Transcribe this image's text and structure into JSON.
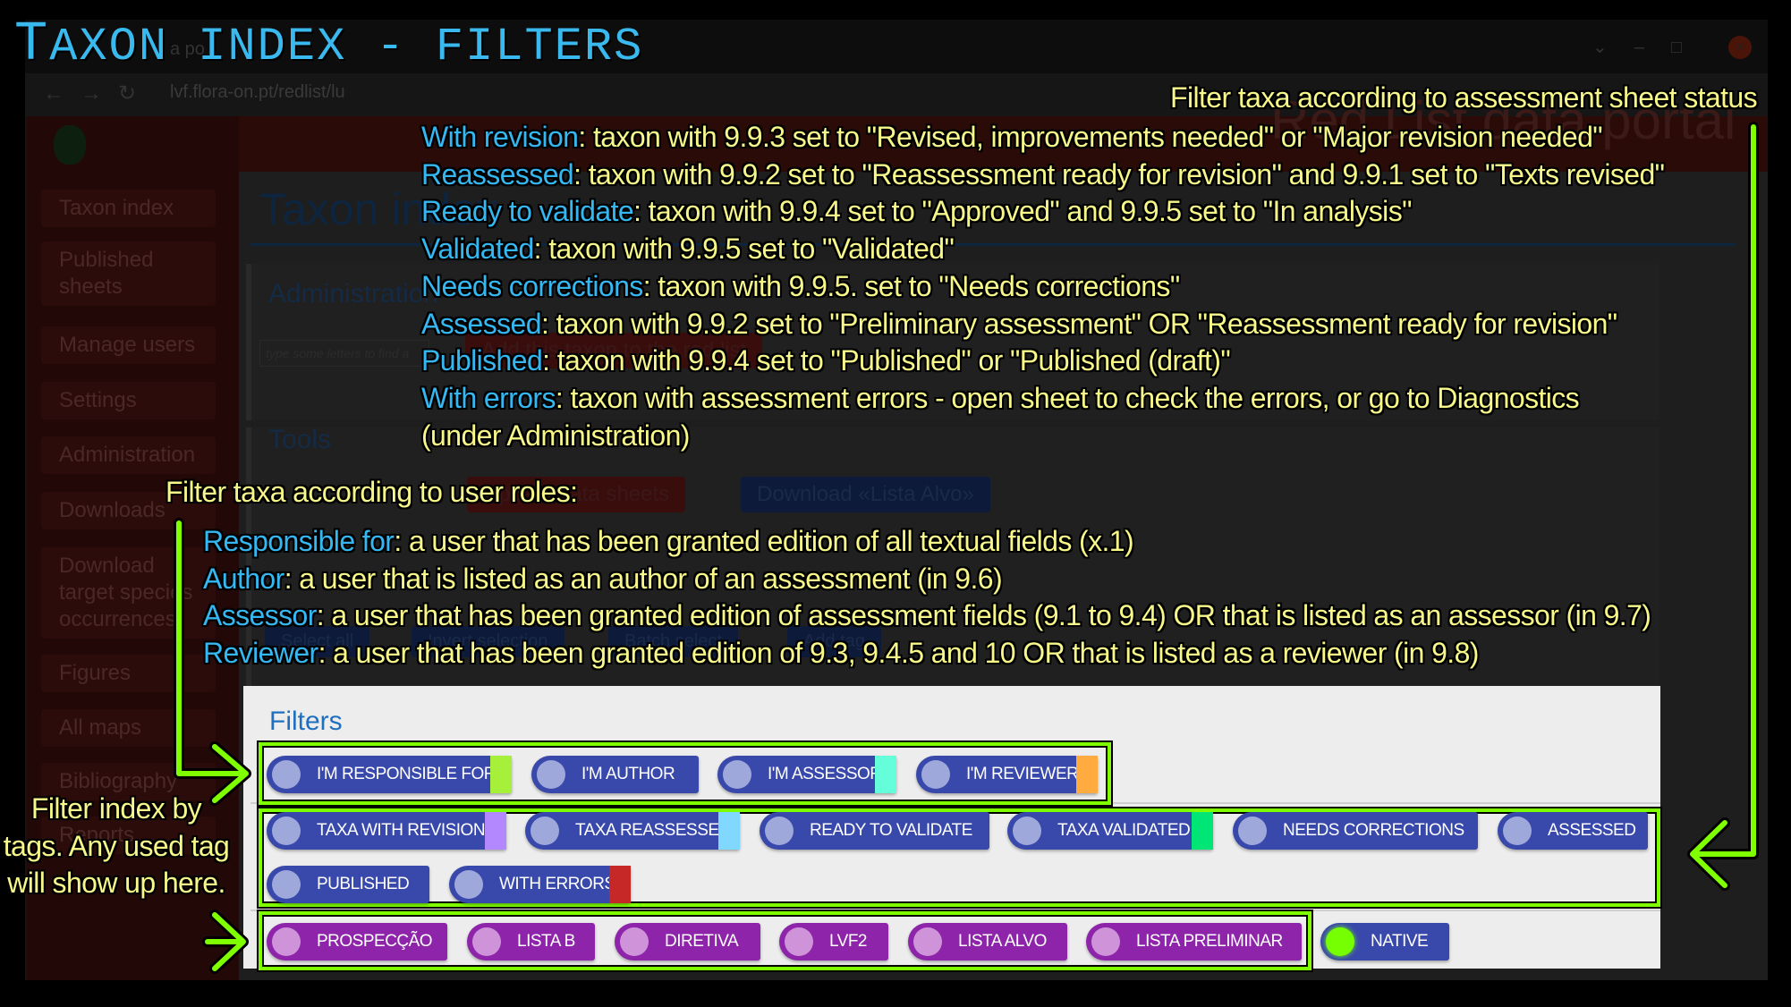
{
  "title": "Taxon index - filters",
  "browser": {
    "tab_text": "a po",
    "url": "lvf.flora-on.pt/redlist/lu",
    "nav_icons": [
      "back-icon",
      "forward-icon",
      "reload-icon"
    ]
  },
  "app": {
    "portal_title": "Red List data portal",
    "sidebar": [
      "Taxon index",
      "Published sheets",
      "Manage users",
      "Settings",
      "Administration",
      "Downloads",
      "Download target species occurrences",
      "Figures",
      "All maps",
      "Bibliography",
      "Reports"
    ],
    "page_title": "Taxon index",
    "admin_title": "Administration",
    "search_placeholder": "type some letters to find a",
    "add_taxon_button": "Add this taxon to the red list",
    "tools_title": "Tools",
    "update_button": "Update data sheets",
    "download_button": "Download «Lista Alvo»",
    "select_buttons": [
      "Select all",
      "Invert selection",
      "Batch select",
      "Add tag"
    ]
  },
  "filters": {
    "title": "Filters",
    "roles": [
      {
        "label": "I'm responsible for",
        "color": "#a6f03c"
      },
      {
        "label": "I'm author",
        "color": ""
      },
      {
        "label": "I'm assessor",
        "color": "#64ffda"
      },
      {
        "label": "I'm reviewer",
        "color": "#ffab40"
      }
    ],
    "status": [
      {
        "label": "Taxa with revision",
        "color": "#b388ff"
      },
      {
        "label": "Taxa reassessed",
        "color": "#80d8ff"
      },
      {
        "label": "Ready to validate",
        "color": ""
      },
      {
        "label": "Taxa validated",
        "color": "#00e676"
      },
      {
        "label": "Needs corrections",
        "color": ""
      },
      {
        "label": "Assessed",
        "color": ""
      },
      {
        "label": "Published",
        "color": ""
      },
      {
        "label": "With errors",
        "color": "#c62828"
      }
    ],
    "tags": [
      "Prospecção",
      "Lista B",
      "Diretiva",
      "LVF2",
      "Lista Alvo",
      "Lista preliminar"
    ],
    "native": {
      "label": "Native",
      "color": "#76ff03"
    }
  },
  "annotations": {
    "status_header": "Filter taxa according to assessment sheet status",
    "status_items": [
      {
        "key": "With revision",
        "text": ": taxon with 9.9.3 set to \"Revised, improvements needed\" or \"Major revision needed\""
      },
      {
        "key": "Reassessed",
        "text": ": taxon with 9.9.2 set to \"Reassessment ready for revision\" and 9.9.1 set to \"Texts revised\""
      },
      {
        "key": "Ready to validate",
        "text": ": taxon with 9.9.4 set to \"Approved\" and 9.9.5 set to \"In analysis\""
      },
      {
        "key": "Validated",
        "text": ": taxon with 9.9.5 set to \"Validated\""
      },
      {
        "key": "Needs corrections",
        "text": ": taxon with 9.9.5. set to \"Needs corrections\""
      },
      {
        "key": "Assessed",
        "text": ": taxon with 9.9.2 set to \"Preliminary assessment\" OR \"Reassessment ready for revision\""
      },
      {
        "key": "Published",
        "text": ": taxon with 9.9.4 set to \"Published\" or \"Published (draft)\""
      },
      {
        "key": "With errors",
        "text": ": taxon with assessment errors - open sheet to check the errors, or go to Diagnostics"
      }
    ],
    "status_last_line": "(under Administration)",
    "roles_header": "Filter taxa according to user roles:",
    "roles_items": [
      {
        "key": "Responsible for",
        "text": ": a user that has been granted edition of all textual fields (x.1)"
      },
      {
        "key": "Author",
        "text": ": a user that is listed as an author of an assessment (in 9.6)"
      },
      {
        "key": "Assessor",
        "text": ": a user that has been granted edition of assessment fields (9.1 to 9.4) OR that is listed as an assessor (in 9.7)"
      },
      {
        "key": "Reviewer",
        "text": ": a user that has been granted edition of 9.3, 9.4.5 and 10 OR that is listed as a reviewer (in 9.8)"
      }
    ],
    "tags_note": "Filter index by tags. Any used tag will show up here.",
    "accent_green": "#7fff00"
  }
}
